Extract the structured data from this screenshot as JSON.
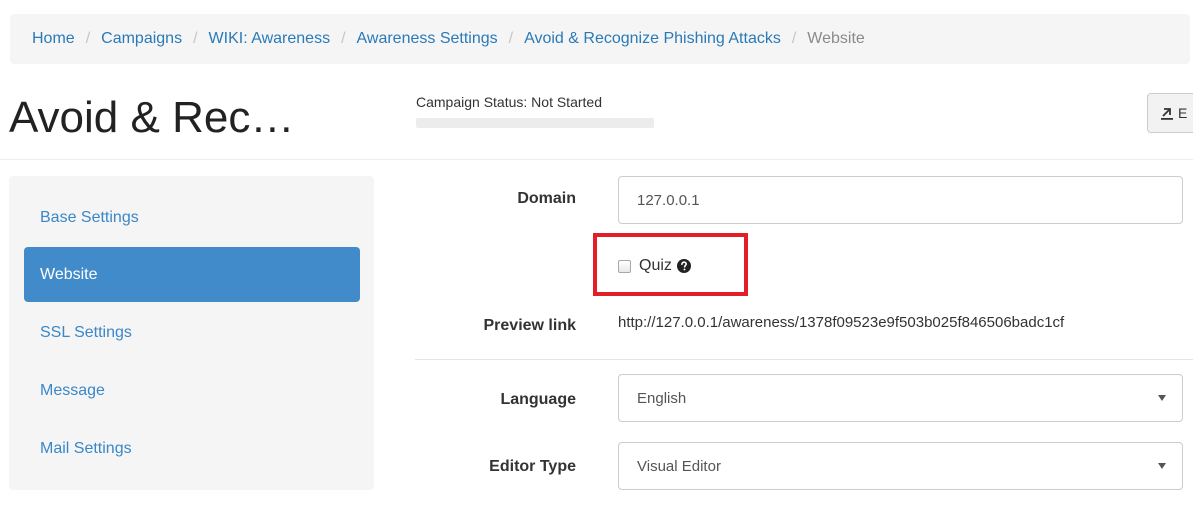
{
  "breadcrumb": {
    "items": [
      "Home",
      "Campaigns",
      "WIKI: Awareness",
      "Awareness Settings",
      "Avoid & Recognize Phishing Attacks"
    ],
    "active": "Website",
    "separator": "/"
  },
  "header": {
    "title": "Avoid & Rec…",
    "campaign_status": "Campaign Status:  Not Started",
    "progress": 0,
    "export_label": "E",
    "export_icon": "export-icon"
  },
  "sidebar": {
    "items": [
      {
        "label": "Base Settings",
        "active": false
      },
      {
        "label": "Website",
        "active": true
      },
      {
        "label": "SSL Settings",
        "active": false
      },
      {
        "label": "Message",
        "active": false
      },
      {
        "label": "Mail Settings",
        "active": false
      }
    ]
  },
  "form": {
    "domain_label": "Domain",
    "domain_value": "127.0.0.1",
    "quiz_label": "Quiz",
    "quiz_checked": false,
    "quiz_help_icon": "question-circle-icon",
    "preview_label": "Preview link",
    "preview_value": "http://127.0.0.1/awareness/1378f09523e9f503b025f846506badc1cf",
    "language_label": "Language",
    "language_value": "English",
    "editor_label": "Editor Type",
    "editor_value": "Visual Editor"
  },
  "colors": {
    "accent": "#428bca",
    "link": "#2a7ab8",
    "highlight": "#e41e26"
  }
}
